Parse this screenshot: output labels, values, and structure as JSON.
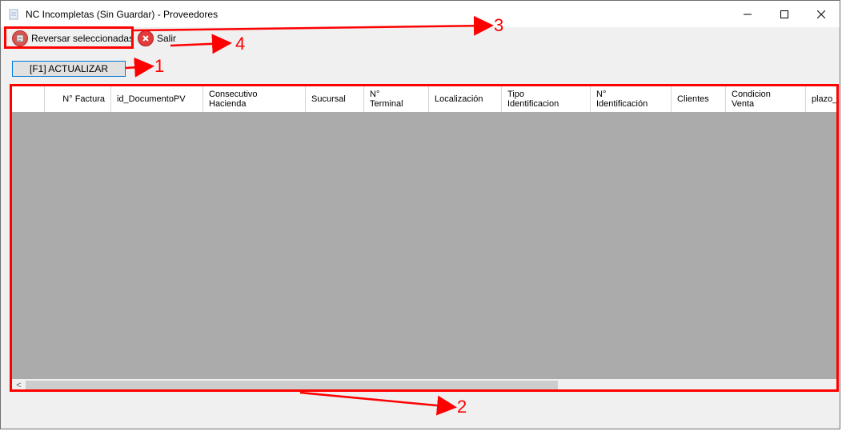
{
  "window": {
    "title": "NC Incompletas (Sin Guardar) - Proveedores",
    "controls": {
      "minimize": "—",
      "maximize": "☐",
      "close": "✕"
    }
  },
  "toolbar": {
    "reverse_label": "Reversar seleccionadas",
    "exit_label": "Salir",
    "reverse_icon": "reverse-icon",
    "exit_icon": "close-circle-icon"
  },
  "refresh_button": "[F1] ACTUALIZAR",
  "grid": {
    "columns": [
      "N° Factura",
      "id_DocumentoPV",
      "Consecutivo\nHacienda",
      "Sucursal",
      "N°\nTerminal",
      "Localización",
      "Tipo\nIdentificacion",
      "N°\nIdentificación",
      "Clientes",
      "Condicion\nVenta",
      "plazo_"
    ],
    "scroll_left_glyph": "<"
  },
  "annotations": {
    "a1": "1",
    "a2": "2",
    "a3": "3",
    "a4": "4"
  },
  "colors": {
    "annotation": "#ff0000",
    "grid_bg": "#ababab",
    "focus": "#0078d7"
  }
}
